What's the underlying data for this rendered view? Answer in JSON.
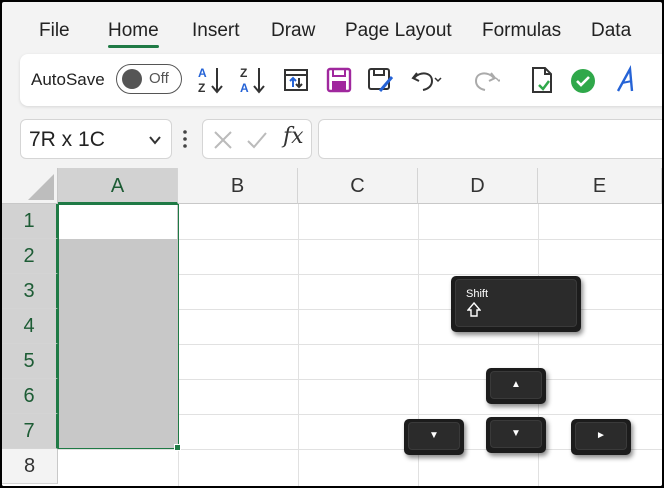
{
  "menu": [
    "File",
    "Home",
    "Insert",
    "Draw",
    "Page Layout",
    "Formulas",
    "Data"
  ],
  "menu_active": "Home",
  "ribbon": {
    "autosave_label": "AutoSave",
    "autosave_state": "Off",
    "icons": [
      "sort-ascending-icon",
      "sort-descending-icon",
      "refresh-icon",
      "save-icon",
      "save-as-icon",
      "undo-icon",
      "redo-icon",
      "document-icon",
      "check-circle-icon",
      "text-direction-icon"
    ]
  },
  "formula_bar": {
    "name_box": "7R x 1C",
    "fx_label": "fx",
    "value": ""
  },
  "grid": {
    "columns": [
      "A",
      "B",
      "C",
      "D",
      "E"
    ],
    "rows": [
      "1",
      "2",
      "3",
      "4",
      "5",
      "6",
      "7",
      "8"
    ],
    "selected_column": "A",
    "selected_rows": [
      "1",
      "2",
      "3",
      "4",
      "5",
      "6",
      "7"
    ]
  },
  "keys": {
    "shift_label": "Shift",
    "up_arrow": "▲",
    "down_arrow": "▼",
    "left_arrow": "▼",
    "right_arrow": "►"
  },
  "colors": {
    "accent": "#1f7a45",
    "selection": "#c8c8c8",
    "key_face": "#1c1c1c",
    "check_green": "#2fa84a",
    "save_purple": "#a0289e",
    "font_blue": "#2563d6"
  }
}
